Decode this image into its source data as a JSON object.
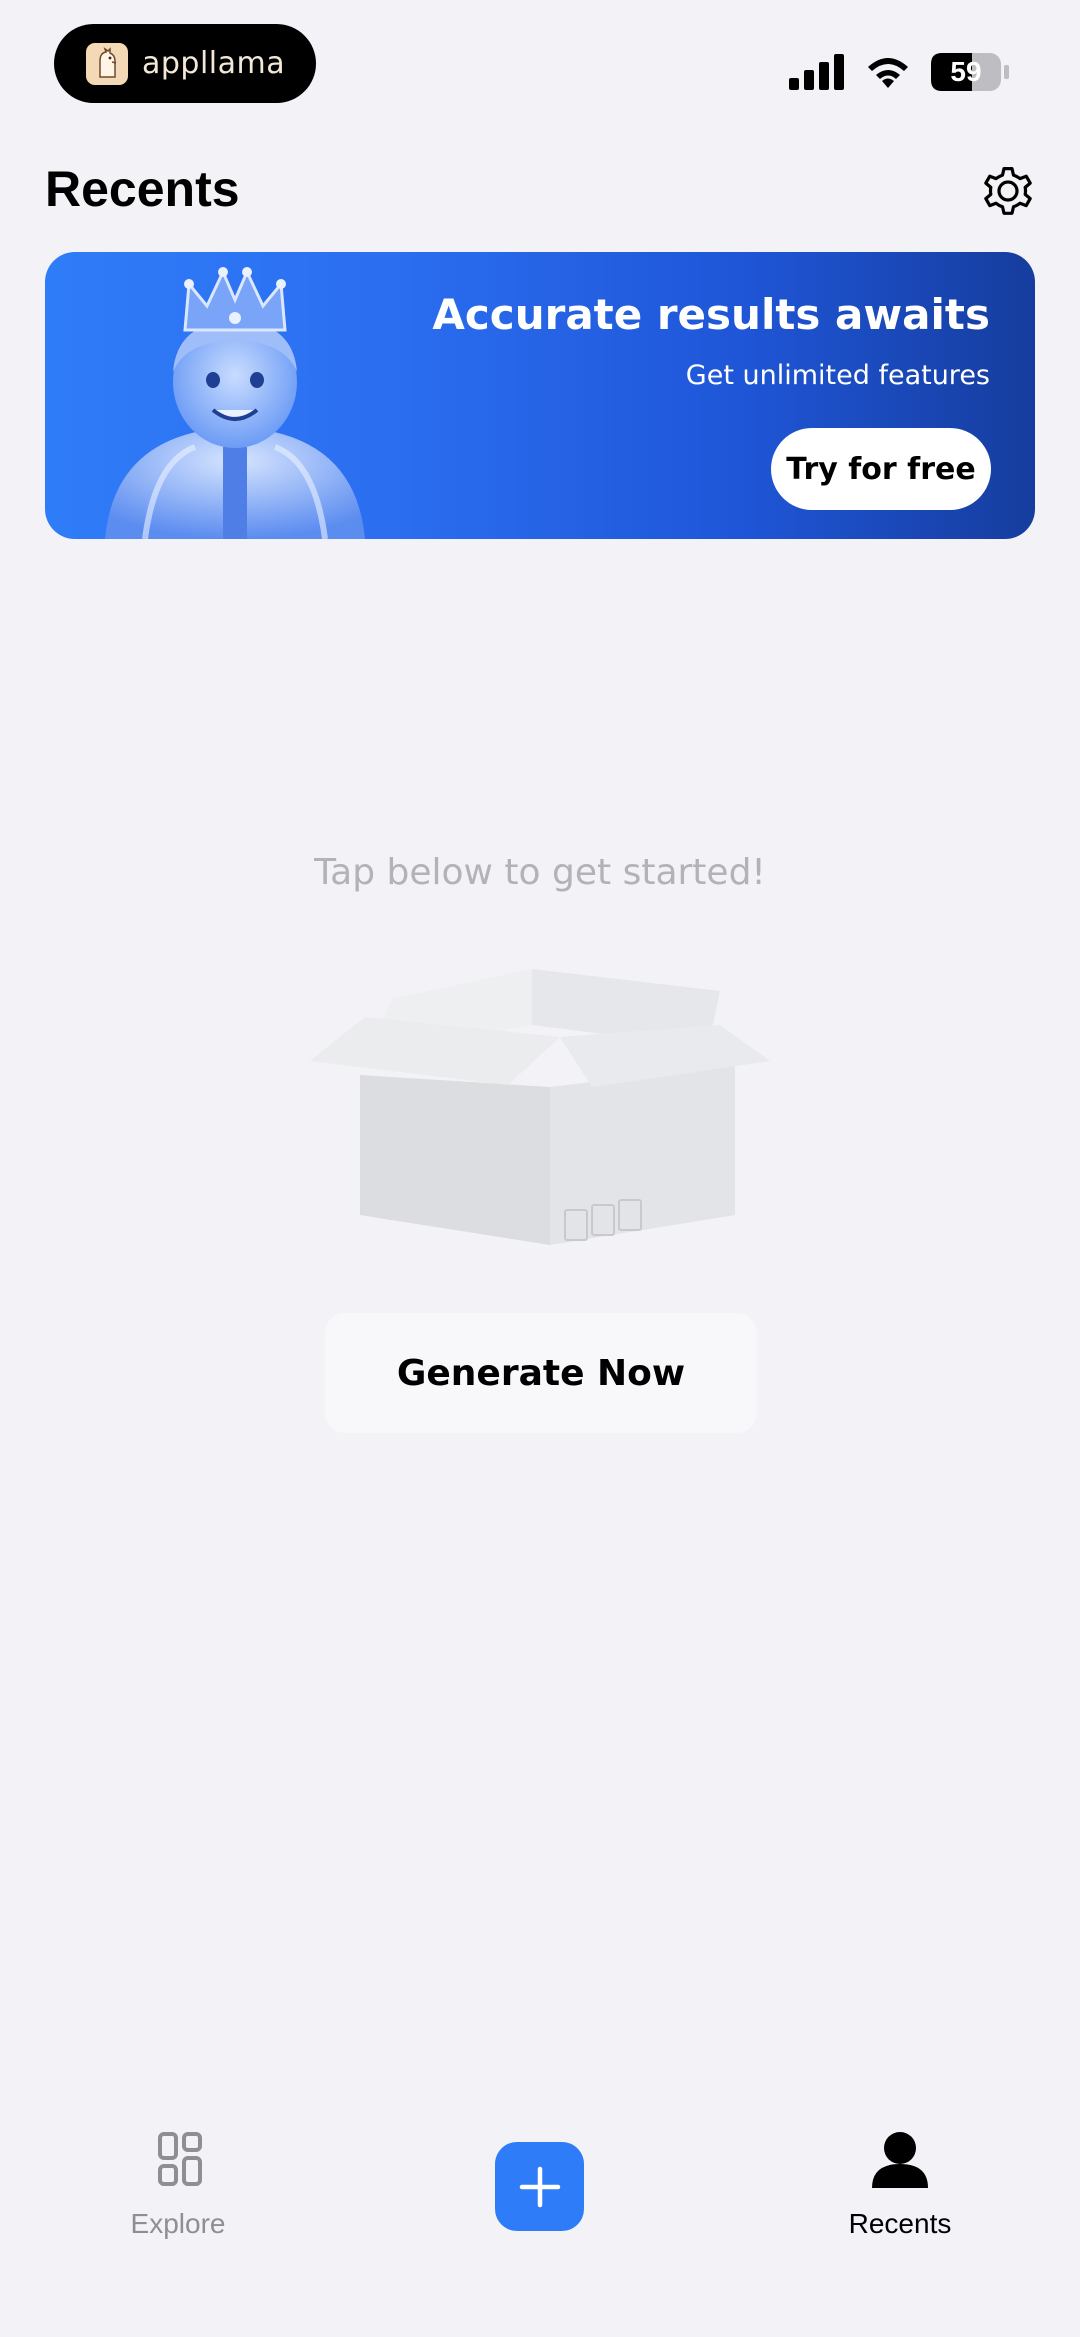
{
  "status_bar": {
    "app_name": "appllama",
    "battery_level": "59",
    "icons": [
      "signal-icon",
      "wifi-icon",
      "battery-icon"
    ]
  },
  "header": {
    "title": "Recents",
    "settings_icon": "gear-icon"
  },
  "banner": {
    "title": "Accurate results awaits",
    "subtitle": "Get unlimited features",
    "cta_label": "Try for free",
    "image": "child-with-crown-illustration"
  },
  "empty_state": {
    "hint": "Tap below to get started!",
    "illustration": "empty-box-illustration",
    "button_label": "Generate Now"
  },
  "tab_bar": {
    "explore_label": "Explore",
    "explore_icon": "grid-icon",
    "add_icon": "plus-icon",
    "recents_label": "Recents",
    "recents_icon": "person-icon",
    "active_tab": "Recents"
  },
  "colors": {
    "accent": "#2f7cf8",
    "background": "#f2f2f7",
    "muted_text": "#b2b2b7",
    "inactive_tab": "#8e8e93"
  }
}
